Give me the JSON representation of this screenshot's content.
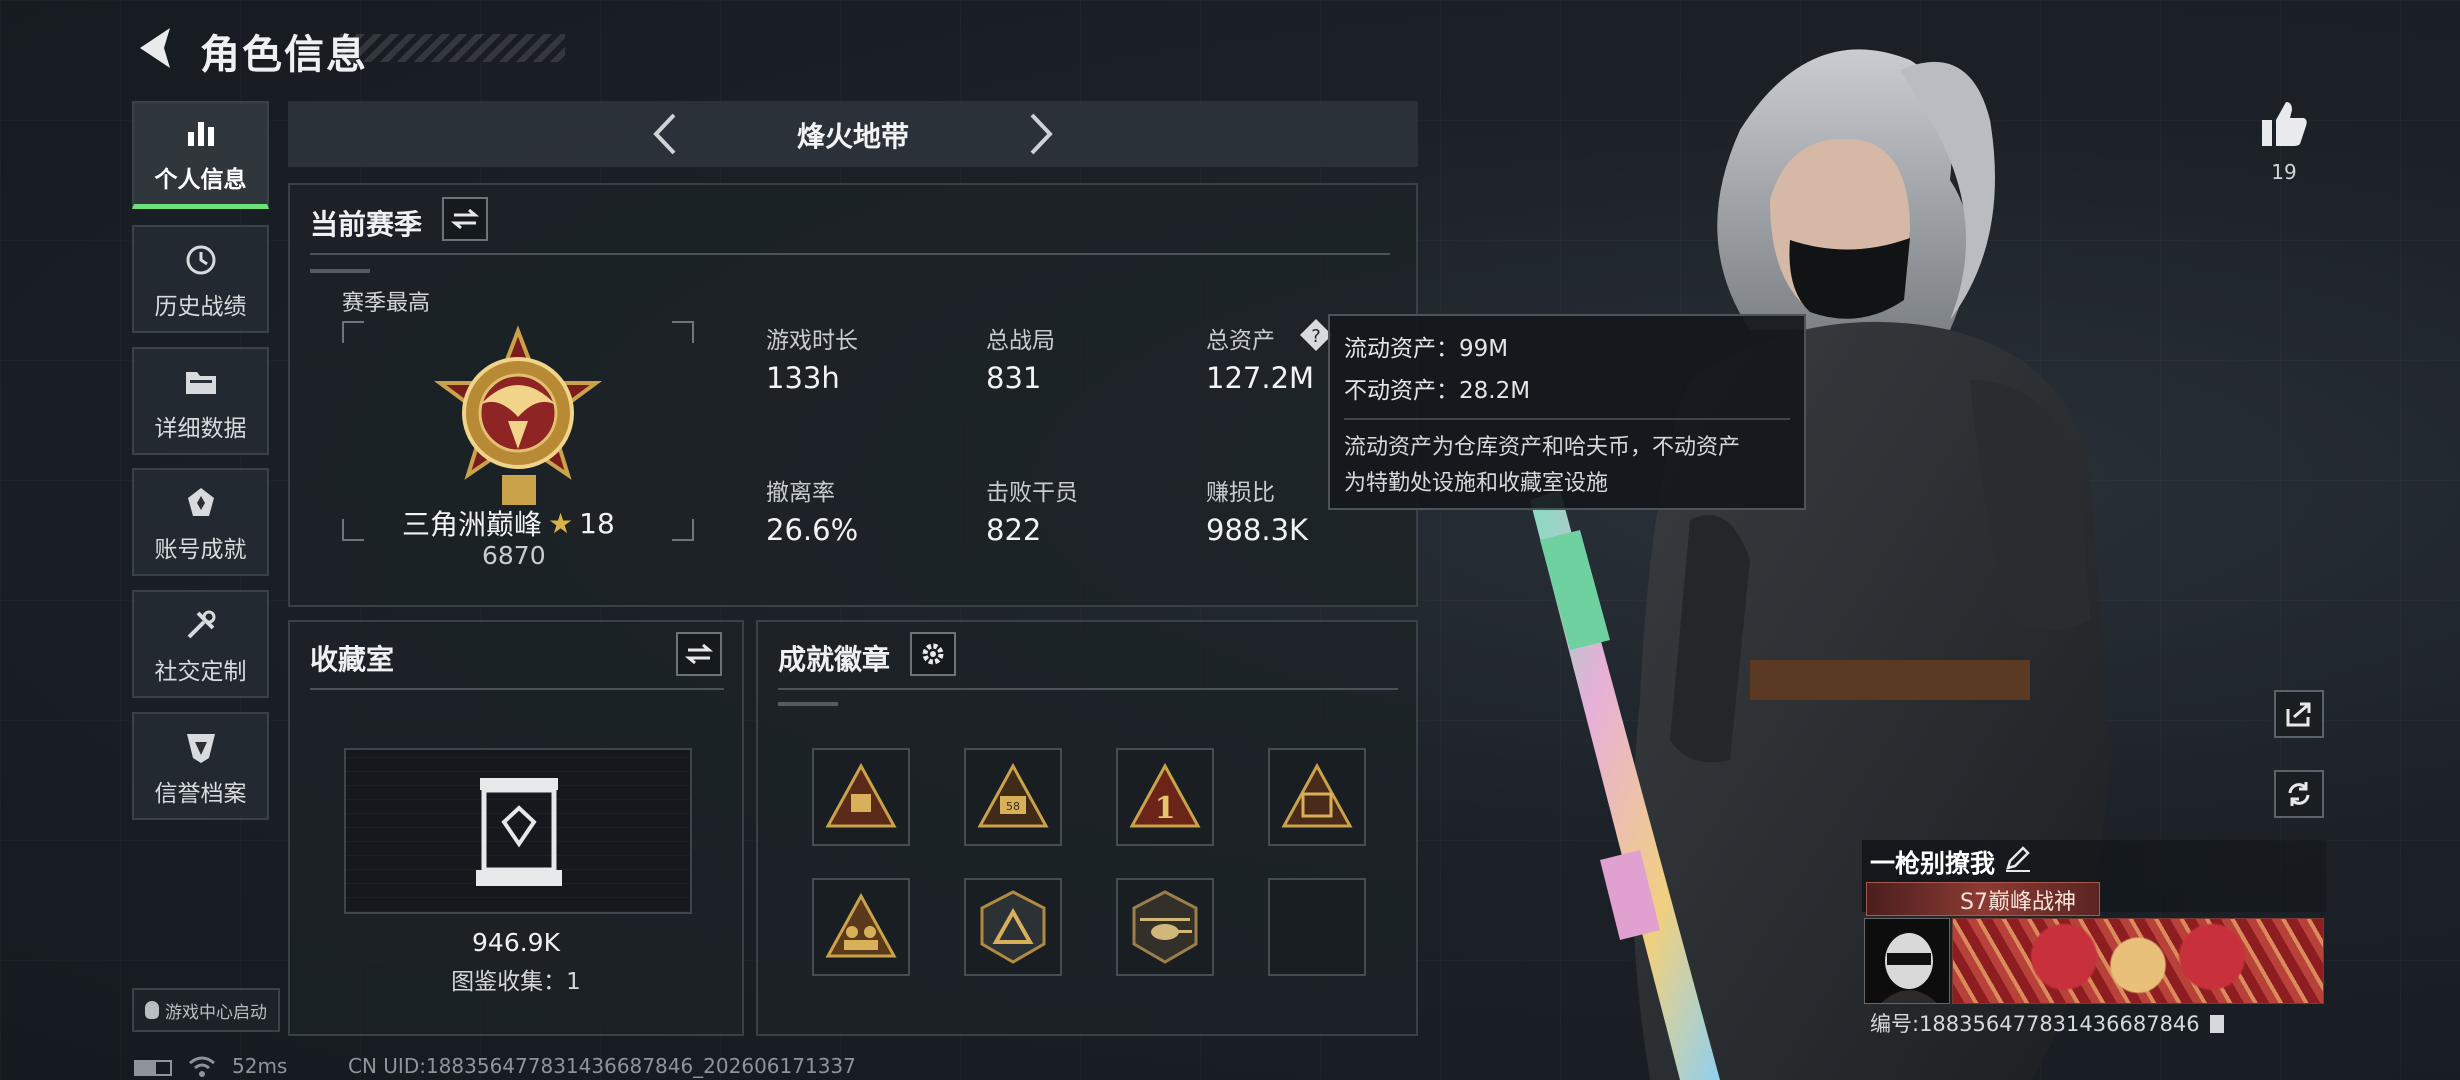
{
  "header": {
    "title": "角色信息"
  },
  "sidebar": {
    "items": [
      {
        "label": "个人信息",
        "icon": "bar-chart-icon",
        "active": true
      },
      {
        "label": "历史战绩",
        "icon": "history-clock-icon",
        "active": false
      },
      {
        "label": "详细数据",
        "icon": "folder-icon",
        "active": false
      },
      {
        "label": "账号成就",
        "icon": "achievement-badge-icon",
        "active": false
      },
      {
        "label": "社交定制",
        "icon": "tools-icon",
        "active": false
      },
      {
        "label": "信誉档案",
        "icon": "credit-shield-icon",
        "active": false
      }
    ],
    "launch_label": "游戏中心启动"
  },
  "mode": {
    "name": "烽火地带"
  },
  "season": {
    "title": "当前赛季",
    "peak_label": "赛季最高",
    "rank_name": "三角洲巅峰",
    "rank_stars": "18",
    "rank_points": "6870",
    "stats": [
      {
        "label": "游戏时长",
        "value": "133h"
      },
      {
        "label": "总战局",
        "value": "831"
      },
      {
        "label": "总资产",
        "value": "127.2M"
      },
      {
        "label": "撤离率",
        "value": "26.6%"
      },
      {
        "label": "击败干员",
        "value": "822"
      },
      {
        "label": "赚损比",
        "value": "988.3K"
      }
    ]
  },
  "tooltip": {
    "liquid": "流动资产：99M",
    "fixed": "不动资产：28.2M",
    "desc_line1": "流动资产为仓库资产和哈夫币，不动资产",
    "desc_line2": "为特勤处设施和收藏室设施"
  },
  "collection": {
    "title": "收藏室",
    "value": "946.9K",
    "catalog": "图鉴收集：1"
  },
  "badges": {
    "title": "成就徽章",
    "slots": [
      {
        "icon": "triangle-crate-badge",
        "filled": true
      },
      {
        "icon": "triangle-58-badge",
        "filled": true
      },
      {
        "icon": "triangle-number-1-badge",
        "filled": true
      },
      {
        "icon": "triangle-card-badge",
        "filled": true
      },
      {
        "icon": "triangle-squad-badge",
        "filled": true
      },
      {
        "icon": "hexagon-triangle-badge",
        "filled": true
      },
      {
        "icon": "helicopter-badge",
        "filled": true
      },
      {
        "icon": "empty-slot",
        "filled": false
      }
    ]
  },
  "social": {
    "likes": "19"
  },
  "player": {
    "name": "一枪别撩我",
    "title_badge": "S7巅峰战神",
    "id_text": "编号:188356477831436687846"
  },
  "status_bar": {
    "ping": "52ms",
    "uid": "CN UID:188356477831436687846_202606171337"
  },
  "colors": {
    "accent_green": "#6ee07a",
    "panel_bg": "#1c2227",
    "gold": "#c9a24a"
  }
}
